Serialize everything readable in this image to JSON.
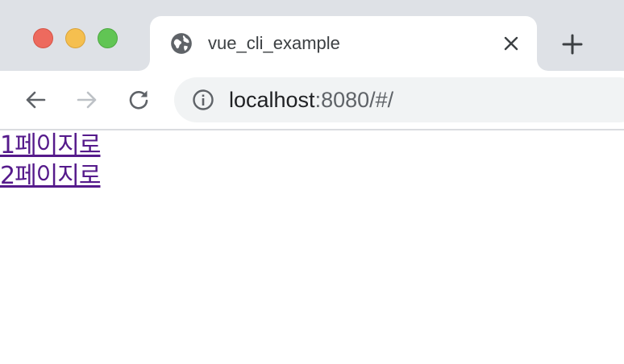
{
  "browser": {
    "tab": {
      "title": "vue_cli_example"
    },
    "address_bar": {
      "host": "localhost",
      "rest": ":8080/#/"
    }
  },
  "colors": {
    "chrome_bg": "#dee1e6",
    "link_visited": "#551a8b",
    "traffic_close": "#ed6a5e",
    "traffic_minimize": "#f5bf4f",
    "traffic_zoom": "#61c554"
  },
  "icons": {
    "tab_favicon": "globe-icon",
    "tab_close": "close-icon",
    "new_tab": "plus-icon",
    "back": "arrow-left-icon",
    "forward": "arrow-right-icon",
    "reload": "reload-icon",
    "site_info": "info-icon"
  },
  "page": {
    "links": [
      {
        "label": "1페이지로"
      },
      {
        "label": "2페이지로"
      }
    ]
  }
}
